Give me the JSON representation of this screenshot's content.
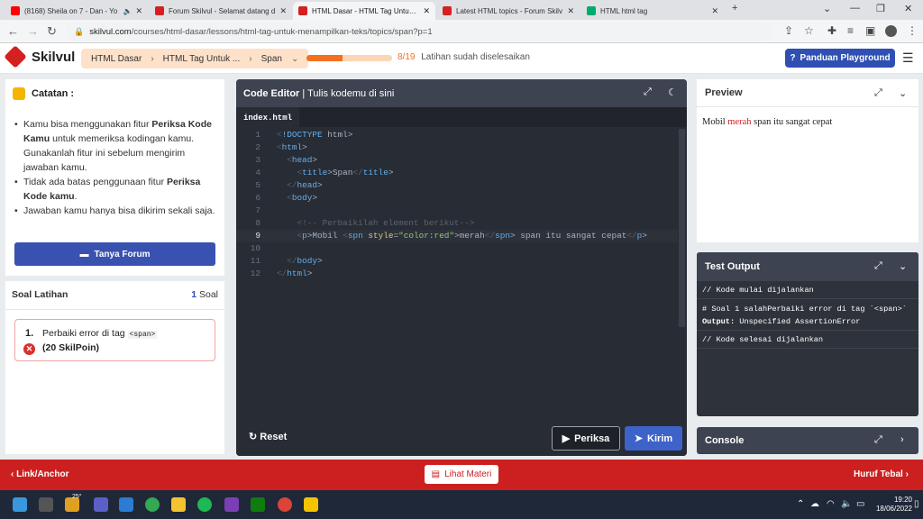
{
  "browser": {
    "tabs": [
      {
        "title": "(8168) Sheila on 7 - Dan - Yo",
        "icon_color": "#ff0000",
        "active": false
      },
      {
        "title": "Forum Skilvul - Selamat datang d",
        "icon_color": "#d42020",
        "active": false
      },
      {
        "title": "HTML Dasar - HTML Tag Untuk M",
        "icon_color": "#d42020",
        "active": true
      },
      {
        "title": "Latest HTML topics - Forum Skilv",
        "icon_color": "#d42020",
        "active": false
      },
      {
        "title": "HTML html tag",
        "icon_color": "#04aa6d",
        "active": false
      }
    ],
    "url_domain": "skilvul.com",
    "url_path": "/courses/html-dasar/lessons/html-tag-untuk-menampilkan-teks/topics/span?p=1"
  },
  "header": {
    "brand": "Skilvul",
    "breadcrumb": [
      "HTML Dasar",
      "HTML Tag Untuk ...",
      "Span"
    ],
    "progress": {
      "current": 8,
      "total": 19,
      "fraction_text": "8/19",
      "label": "Latihan sudah diselesaikan"
    },
    "playground_label": "Panduan Playground"
  },
  "notes": {
    "title": "Catatan :",
    "items": [
      {
        "pre": "Kamu bisa menggunakan fitur ",
        "bold": "Periksa Kode Kamu",
        "post": " untuk memeriksa kodingan kamu. Gunakanlah fitur ini sebelum mengirim jawaban kamu."
      },
      {
        "pre": "Tidak ada batas penggunaan fitur ",
        "bold": "Periksa Kode kamu",
        "post": "."
      },
      {
        "pre": "Jawaban kamu hanya bisa dikirim sekali saja.",
        "bold": "",
        "post": ""
      }
    ],
    "forum_button": "Tanya Forum"
  },
  "exercise": {
    "title": "Soal Latihan",
    "count_num": "1",
    "count_unit": "Soal",
    "question_no": "1.",
    "question_text": "Perbaiki error di tag",
    "question_code": "<span>",
    "points": "(20 SkilPoin)"
  },
  "editor": {
    "title_bold": "Code Editor",
    "title_rest": "| Tulis kodemu di sini",
    "file_tab": "index.html",
    "lines": [
      "<!DOCTYPE html>",
      "<html>",
      "  <head>",
      "    <title>Span</title>",
      "  </head>",
      "  <body>",
      "",
      "    <!-- Perbaikilah element berikut-->",
      "    <p>Mobil <spn style=\"color:red\">merah</spn> span itu sangat cepat</p>",
      "",
      "  </body>",
      "</html>"
    ],
    "current_line": 9,
    "reset_label": "Reset",
    "check_label": "Periksa",
    "submit_label": "Kirim"
  },
  "preview": {
    "title": "Preview",
    "text_before": "Mobil ",
    "text_red": "merah",
    "text_after": " span itu sangat cepat"
  },
  "test_output": {
    "title": "Test Output",
    "lines": [
      "// Kode mulai dijalankan",
      "# Soal 1 salahPerbaiki error di tag `<span>`",
      "// Kode selesai dijalankan"
    ],
    "output_label": "Output:",
    "output_value": "Unspecified AssertionError"
  },
  "console": {
    "title": "Console"
  },
  "bottom_nav": {
    "prev": "Link/Anchor",
    "materi": "Lihat Materi",
    "next": "Huruf Tebal"
  },
  "taskbar": {
    "temperature": "25°",
    "time": "19:20",
    "date": "18/06/2022"
  }
}
